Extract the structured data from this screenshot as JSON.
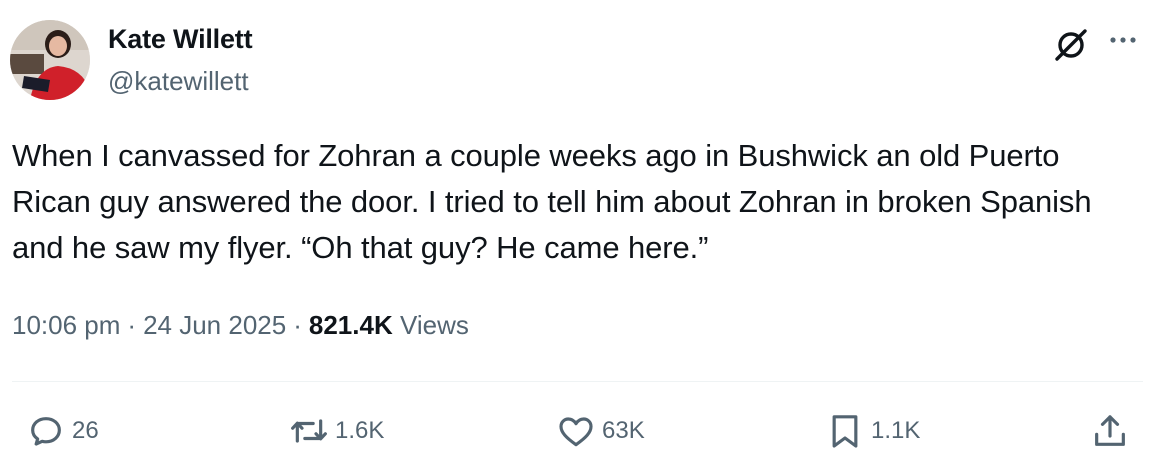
{
  "author": {
    "name": "Kate Willett",
    "handle": "@katewillett",
    "avatar_icon": "profile-photo"
  },
  "tweet": {
    "text": "When I canvassed for Zohran a couple weeks ago in Bushwick an old Puerto Rican guy answered the door. I tried to tell him about Zohran in broken Spanish and he saw my flyer. “Oh that guy? He came here.”"
  },
  "meta": {
    "time": "10:06 pm",
    "separator": "·",
    "date": "24 Jun 2025",
    "views_count": "821.4K",
    "views_label": "Views"
  },
  "actions": {
    "replies": "26",
    "reposts": "1.6K",
    "likes": "63K",
    "bookmarks": "1.1K"
  },
  "icons": {
    "top_right": [
      "grok-icon",
      "more-icon"
    ],
    "actions": [
      "reply-icon",
      "repost-icon",
      "like-icon",
      "bookmark-icon",
      "share-icon"
    ]
  },
  "colors": {
    "text_primary": "#0f1419",
    "text_secondary": "#536471",
    "divider": "#eff3f4"
  }
}
